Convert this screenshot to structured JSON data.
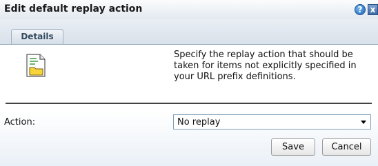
{
  "dialog": {
    "title": "Edit default replay action",
    "help_icon_glyph": "?",
    "close_icon_glyph": "x"
  },
  "tabs": [
    {
      "label": "Details",
      "selected": true
    }
  ],
  "details": {
    "icon": "document-folder-icon",
    "description": "Specify the replay action that should be taken for items not explicitly specified in your URL prefix definitions."
  },
  "action": {
    "label": "Action:",
    "selected_value": "No replay"
  },
  "buttons": {
    "save_label": "Save",
    "cancel_label": "Cancel"
  },
  "colors": {
    "titlebar_top": "#fbfcfd",
    "titlebar_bottom": "#e3e9f0",
    "help_blue": "#1d66b8",
    "close_blue": "#3b6aa6",
    "tab_text": "#34495e"
  }
}
